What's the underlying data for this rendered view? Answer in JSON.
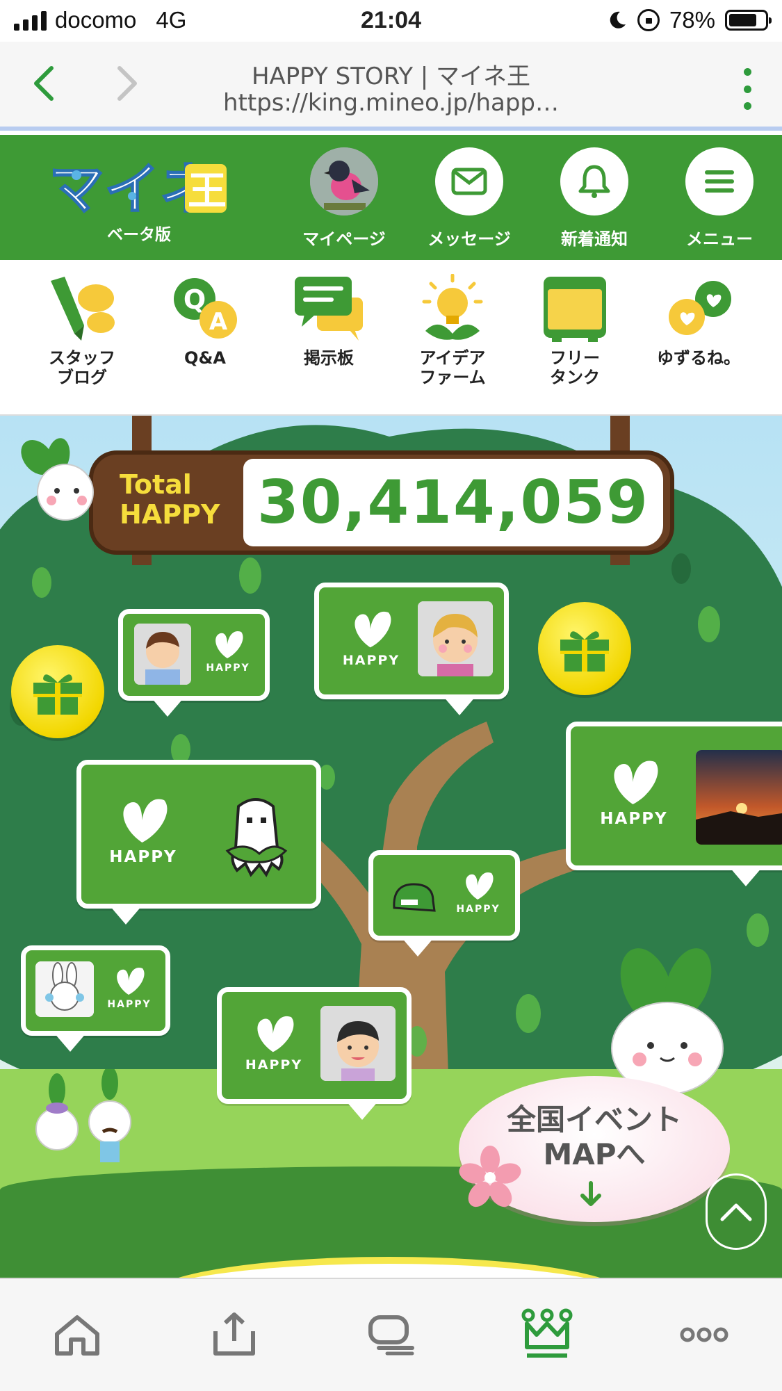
{
  "status_bar": {
    "carrier": "docomo",
    "network": "4G",
    "time": "21:04",
    "battery_percent": "78%",
    "battery_level": 0.78
  },
  "browser": {
    "title": "HAPPY STORY | マイネ王",
    "url": "https://king.mineo.jp/happ…",
    "accent_color": "#2e9b3c"
  },
  "header": {
    "logo_text": "マイネ王",
    "logo_subtitle": "ベータ版",
    "items": [
      {
        "label": "マイページ",
        "icon": "avatar-bird"
      },
      {
        "label": "メッセージ",
        "icon": "envelope-icon"
      },
      {
        "label": "新着通知",
        "icon": "bell-icon"
      },
      {
        "label": "メニュー",
        "icon": "hamburger-icon"
      }
    ],
    "color": "#3e9a35"
  },
  "categories": [
    {
      "label": "スタッフ\nブログ",
      "icon": "pen-speech-icon"
    },
    {
      "label": "Q&A",
      "icon": "qa-icon"
    },
    {
      "label": "掲示板",
      "icon": "board-icon"
    },
    {
      "label": "アイデア\nファーム",
      "icon": "lightbulb-icon"
    },
    {
      "label": "フリー\nタンク",
      "icon": "tank-icon"
    },
    {
      "label": "ゆずるね。",
      "icon": "hearts-icon"
    }
  ],
  "happy": {
    "total_label_1": "Total",
    "total_label_2": "HAPPY",
    "total_value": "30,414,059",
    "bubble_text": "HAPPY"
  },
  "event_button": {
    "label": "全国イベント\nMAPへ",
    "arrow": "↓"
  },
  "toolbar": {
    "items": [
      "home-icon",
      "share-icon",
      "tabs-icon",
      "crown-icon",
      "more-icon"
    ],
    "active_index": 3
  }
}
